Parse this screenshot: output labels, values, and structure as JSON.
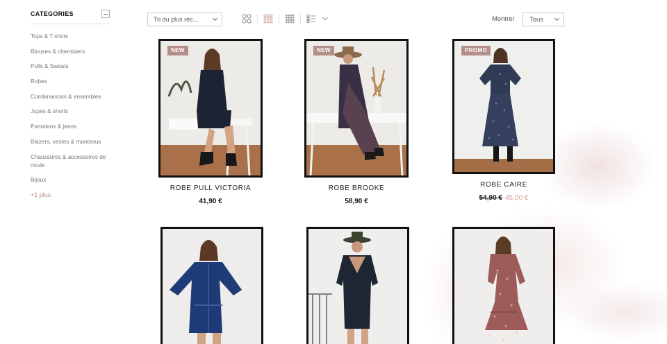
{
  "sidebar": {
    "title": "CATEGORIES",
    "items": [
      "Tops & T-shirts",
      "Blouses & chemisiers",
      "Pulls & Sweats",
      "Robes",
      "Combinaisons & ensembles",
      "Jupes & shorts",
      "Pantalons & jeans",
      "Blazers, vestes & manteaux",
      "Chaussures & accessoires de mode",
      "Bijoux"
    ],
    "more": "+1 plus"
  },
  "toolbar": {
    "sort_value": "Tri du plus réc...",
    "show_label": "Montrer",
    "show_value": "Tous"
  },
  "products": [
    {
      "name": "ROBE PULL VICTORIA",
      "price": "41,90 €",
      "badge": "NEW"
    },
    {
      "name": "ROBE BROOKE",
      "price": "58,90 €",
      "badge": "NEW"
    },
    {
      "name": "ROBE CAIRE",
      "old_price": "54,90 €",
      "price": "45,00 €",
      "badge": "PROMO"
    }
  ],
  "colors": {
    "badge_bg": "#b48e88",
    "sale_price": "#d3a49c",
    "more_link": "#b88a7a"
  }
}
